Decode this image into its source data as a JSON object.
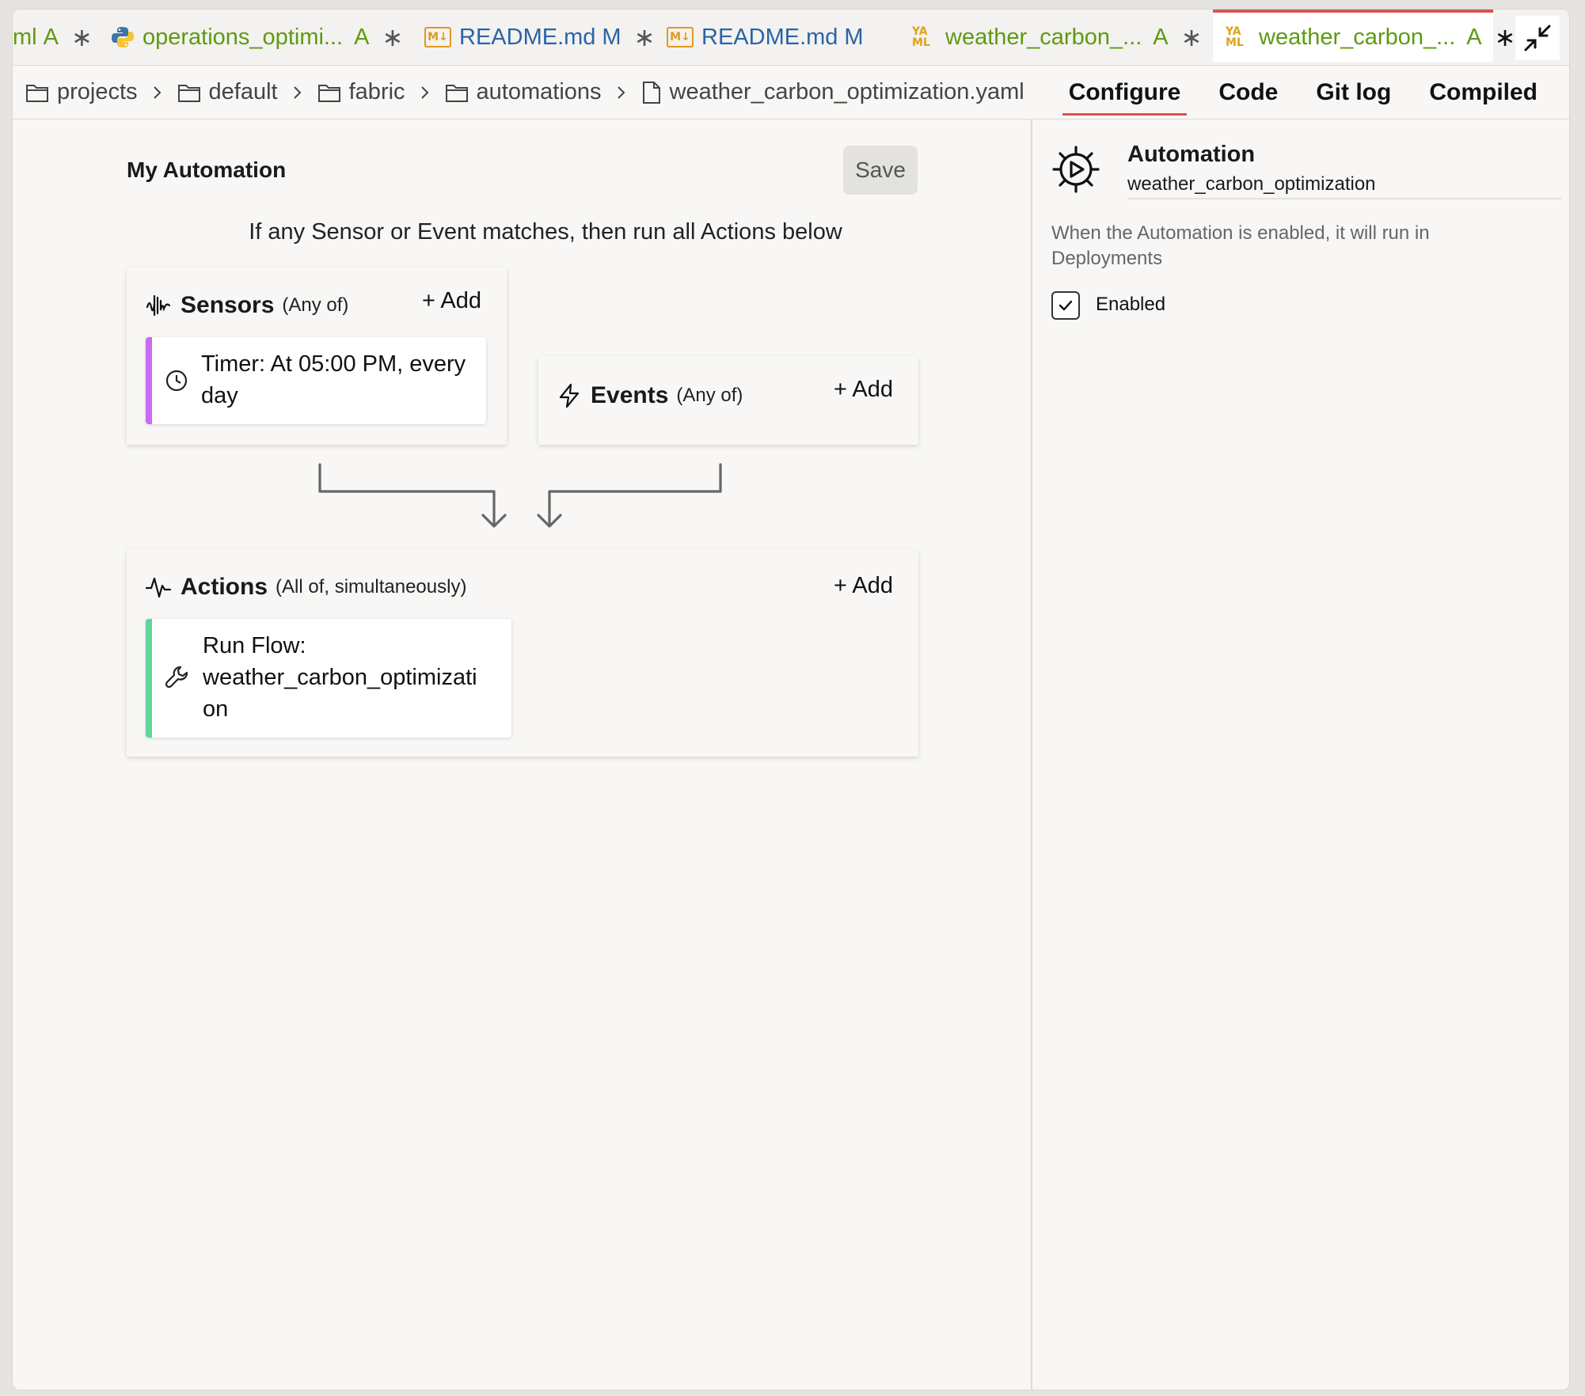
{
  "tabs": [
    {
      "label": "ml",
      "status": "A",
      "close": "∗",
      "color": "green",
      "icon": "none"
    },
    {
      "label": "operations_optimi...",
      "status": "A",
      "close": "∗",
      "color": "green",
      "icon": "python-icon"
    },
    {
      "label": "README.md",
      "status": "M",
      "close": "∗",
      "color": "blue",
      "icon": "markdown-icon"
    },
    {
      "label": "README.md",
      "status": "M",
      "close": "",
      "color": "blue",
      "icon": "markdown-icon"
    },
    {
      "label": "weather_carbon_...",
      "status": "A",
      "close": "∗",
      "color": "green",
      "icon": "yaml-icon"
    },
    {
      "label": "weather_carbon_...",
      "status": "A",
      "close": "∗",
      "color": "green",
      "icon": "yaml-icon",
      "active": true
    }
  ],
  "breadcrumb": [
    "projects",
    "default",
    "fabric",
    "automations",
    "weather_carbon_optimization.yaml"
  ],
  "view_tabs": {
    "configure": "Configure",
    "code": "Code",
    "git_log": "Git log",
    "compiled": "Compiled"
  },
  "editor": {
    "title": "My Automation",
    "save_label": "Save",
    "rule_text": "If any Sensor or Event matches, then run all Actions below",
    "sensors": {
      "title": "Sensors",
      "qualifier": "(Any of)",
      "add_label": "+ Add",
      "item_line1": "Timer: At 05:00 PM, every",
      "item_line2": "day"
    },
    "events": {
      "title": "Events",
      "qualifier": "(Any of)",
      "add_label": "+ Add"
    },
    "actions": {
      "title": "Actions",
      "qualifier": "(All of, simultaneously)",
      "add_label": "+ Add",
      "item_line1": "Run Flow:",
      "item_line2": "weather_carbon_optimizati",
      "item_line3": "on"
    }
  },
  "side_panel": {
    "title": "Automation",
    "name": "weather_carbon_optimization",
    "description": "When the Automation is enabled, it will run in Deployments",
    "enabled_label": "Enabled",
    "enabled": true
  },
  "colors": {
    "sensor_accent": "#c86cf0",
    "action_accent": "#5fd69a",
    "active_tab_border": "#d9534f"
  }
}
